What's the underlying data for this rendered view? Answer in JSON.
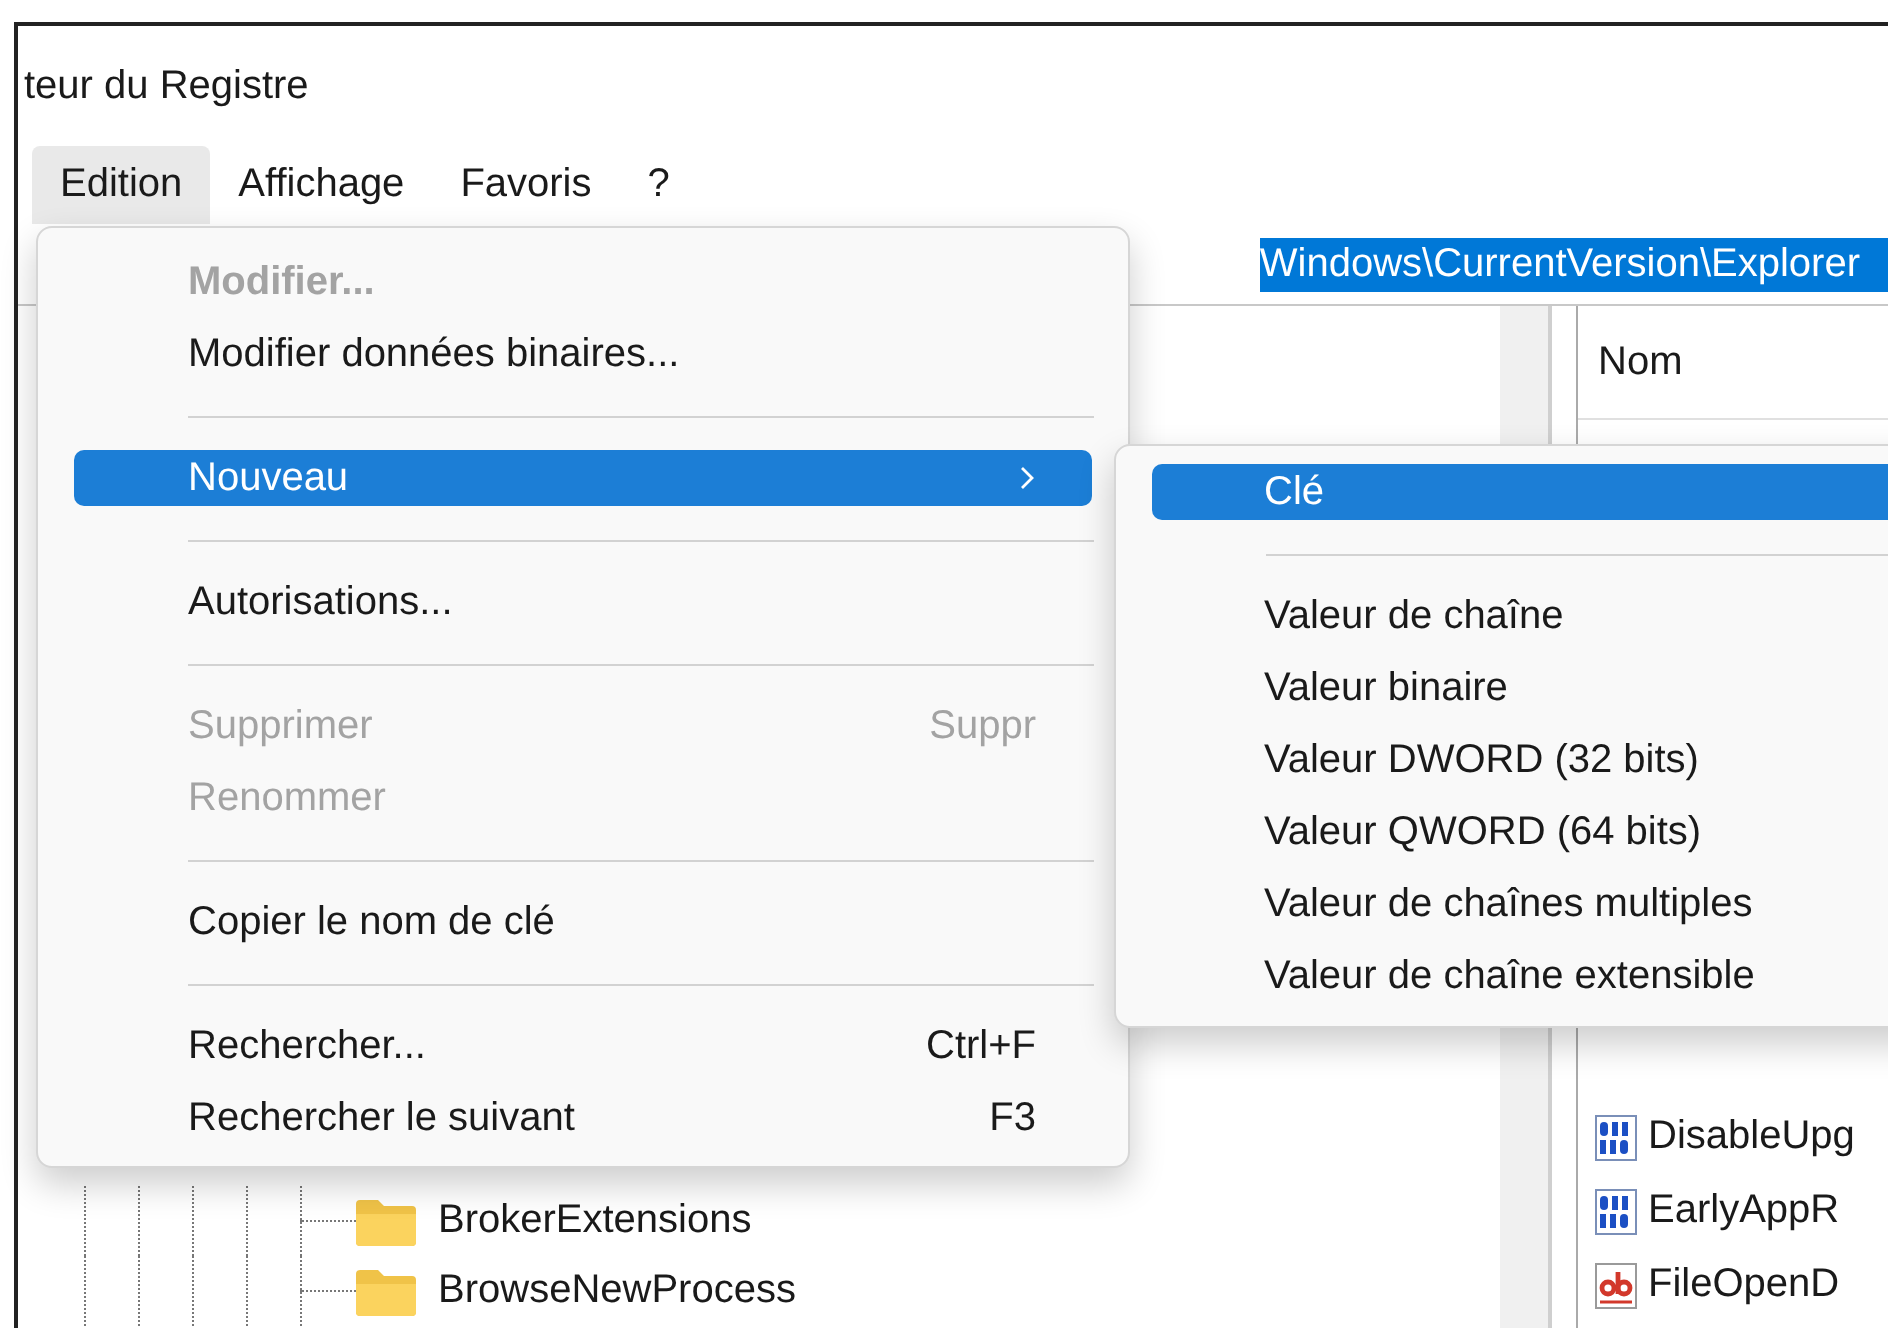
{
  "window": {
    "title": "teur du Registre"
  },
  "menu_bar": [
    {
      "label": "Edition",
      "selected": true
    },
    {
      "label": "Affichage",
      "selected": false
    },
    {
      "label": "Favoris",
      "selected": false
    },
    {
      "label": "?",
      "selected": false
    }
  ],
  "address_bar": {
    "value": "Windows\\CurrentVersion\\Explorer"
  },
  "edit_menu": [
    {
      "kind": "item",
      "label": "Modifier...",
      "default": true,
      "disabled": true,
      "selected": false,
      "submenu": false
    },
    {
      "kind": "item",
      "label": "Modifier données binaires...",
      "default": false,
      "disabled": false,
      "selected": false,
      "submenu": false
    },
    {
      "kind": "separator"
    },
    {
      "kind": "item",
      "label": "Nouveau",
      "default": false,
      "disabled": false,
      "selected": true,
      "submenu": true
    },
    {
      "kind": "separator"
    },
    {
      "kind": "item",
      "label": "Autorisations...",
      "default": false,
      "disabled": false,
      "selected": false,
      "submenu": false
    },
    {
      "kind": "separator"
    },
    {
      "kind": "item",
      "label": "Supprimer",
      "shortcut": "Suppr",
      "default": false,
      "disabled": true,
      "selected": false,
      "submenu": false
    },
    {
      "kind": "item",
      "label": "Renommer",
      "default": false,
      "disabled": true,
      "selected": false,
      "submenu": false
    },
    {
      "kind": "separator"
    },
    {
      "kind": "item",
      "label": "Copier le nom de clé",
      "default": false,
      "disabled": false,
      "selected": false,
      "submenu": false
    },
    {
      "kind": "separator"
    },
    {
      "kind": "item",
      "label": "Rechercher...",
      "shortcut": "Ctrl+F",
      "default": false,
      "disabled": false,
      "selected": false,
      "submenu": false
    },
    {
      "kind": "item",
      "label": "Rechercher le suivant",
      "shortcut": "F3",
      "default": false,
      "disabled": false,
      "selected": false,
      "submenu": false
    }
  ],
  "new_submenu": [
    {
      "kind": "item",
      "label": "Clé",
      "selected": true
    },
    {
      "kind": "separator"
    },
    {
      "kind": "item",
      "label": "Valeur de chaîne",
      "selected": false
    },
    {
      "kind": "item",
      "label": "Valeur binaire",
      "selected": false
    },
    {
      "kind": "item",
      "label": "Valeur DWORD (32 bits)",
      "selected": false
    },
    {
      "kind": "item",
      "label": "Valeur QWORD (64 bits)",
      "selected": false
    },
    {
      "kind": "item",
      "label": "Valeur de chaînes multiples",
      "selected": false
    },
    {
      "kind": "item",
      "label": "Valeur de chaîne extensible",
      "selected": false
    }
  ],
  "tree": [
    {
      "label": "BrokerExtensions"
    },
    {
      "label": "BrowseNewProcess"
    }
  ],
  "values_list": {
    "columns": [
      "Nom"
    ],
    "rows": [
      {
        "name": "DisableUpg",
        "kind": "binary"
      },
      {
        "name": "EarlyAppR",
        "kind": "binary"
      },
      {
        "name": "FileOpenD",
        "kind": "string"
      }
    ]
  }
}
